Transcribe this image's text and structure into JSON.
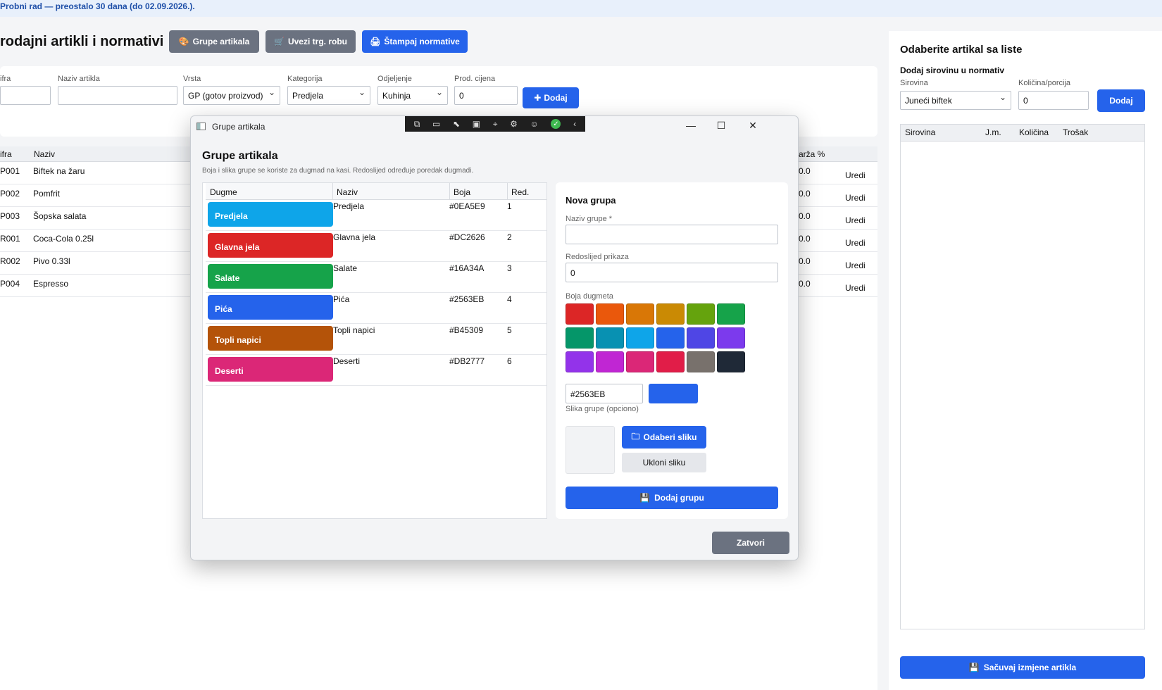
{
  "banner": "Probni rad — preostalo 30 dana (do 02.09.2026.).",
  "page": {
    "title": "rodajni artikli i normativi",
    "toolbar": {
      "groups": "Grupe artikala",
      "import": "Uvezi trg. robu",
      "print": "Štampaj normative"
    },
    "form": {
      "sifra_label": "ifra",
      "naziv_label": "Naziv artikla",
      "vrsta_label": "Vrsta",
      "vrsta_value": "GP (gotov proizvod)",
      "kategorija_label": "Kategorija",
      "kategorija_value": "Predjela",
      "odjeljenje_label": "Odjeljenje",
      "odjeljenje_value": "Kuhinja",
      "cijena_label": "Prod. cijena",
      "cijena_value": "0",
      "add": "Dodaj"
    },
    "table": {
      "headers": [
        "ifra",
        "Naziv",
        "arža %"
      ],
      "rows": [
        {
          "sifra": "P001",
          "naziv": "Biftek na žaru",
          "marza": "0.0",
          "action": "Uredi"
        },
        {
          "sifra": "P002",
          "naziv": "Pomfrit",
          "marza": "0.0",
          "action": "Uredi"
        },
        {
          "sifra": "P003",
          "naziv": "Šopska salata",
          "marza": "0.0",
          "action": "Uredi"
        },
        {
          "sifra": "R001",
          "naziv": "Coca-Cola 0.25l",
          "marza": "0.0",
          "action": "Uredi"
        },
        {
          "sifra": "R002",
          "naziv": "Pivo 0.33l",
          "marza": "0.0",
          "action": "Uredi"
        },
        {
          "sifra": "P004",
          "naziv": "Espresso",
          "marza": "0.0",
          "action": "Uredi"
        }
      ]
    }
  },
  "right": {
    "title": "Odaberite artikal sa liste",
    "subtitle": "Dodaj sirovinu u normativ",
    "sirovina_label": "Sirovina",
    "sirovina_value": "Juneći biftek",
    "kolicina_label": "Količina/porcija",
    "kolicina_value": "0",
    "add": "Dodaj",
    "headers": [
      "Sirovina",
      "J.m.",
      "Količina",
      "Trošak"
    ],
    "save": "Sačuvaj izmjene artikla"
  },
  "dialog": {
    "window_title": "Grupe artikala",
    "title": "Grupe artikala",
    "subtitle": "Boja i slika grupe se koriste za dugmad na kasi. Redoslijed određuje poredak dugmadi.",
    "headers": [
      "Dugme",
      "Naziv",
      "Boja",
      "Red."
    ],
    "groups": [
      {
        "name": "Predjela",
        "color": "#0EA5E9",
        "order": "1"
      },
      {
        "name": "Glavna jela",
        "color": "#DC2626",
        "order": "2"
      },
      {
        "name": "Salate",
        "color": "#16A34A",
        "order": "3"
      },
      {
        "name": "Pića",
        "color": "#2563EB",
        "order": "4"
      },
      {
        "name": "Topli napici",
        "color": "#B45309",
        "order": "5"
      },
      {
        "name": "Deserti",
        "color": "#DB2777",
        "order": "6"
      }
    ],
    "form": {
      "title": "Nova grupa",
      "name_label": "Naziv grupe *",
      "name_value": "",
      "order_label": "Redoslijed prikaza",
      "order_value": "0",
      "color_label": "Boja dugmeta",
      "palette": [
        "#dc2626",
        "#ea580c",
        "#d97706",
        "#ca8a04",
        "#65a30d",
        "#16a34a",
        "#059669",
        "#0891b2",
        "#0ea5e9",
        "#2563eb",
        "#4f46e5",
        "#7c3aed",
        "#9333ea",
        "#c026d3",
        "#db2777",
        "#e11d48",
        "#78716c",
        "#1f2937"
      ],
      "hex_value": "#2563EB",
      "selected_color": "#2563eb",
      "image_label": "Slika grupe (opciono)",
      "pick_image": "Odaberi sliku",
      "remove_image": "Ukloni sliku",
      "add_group": "Dodaj grupu"
    },
    "close": "Zatvori"
  }
}
